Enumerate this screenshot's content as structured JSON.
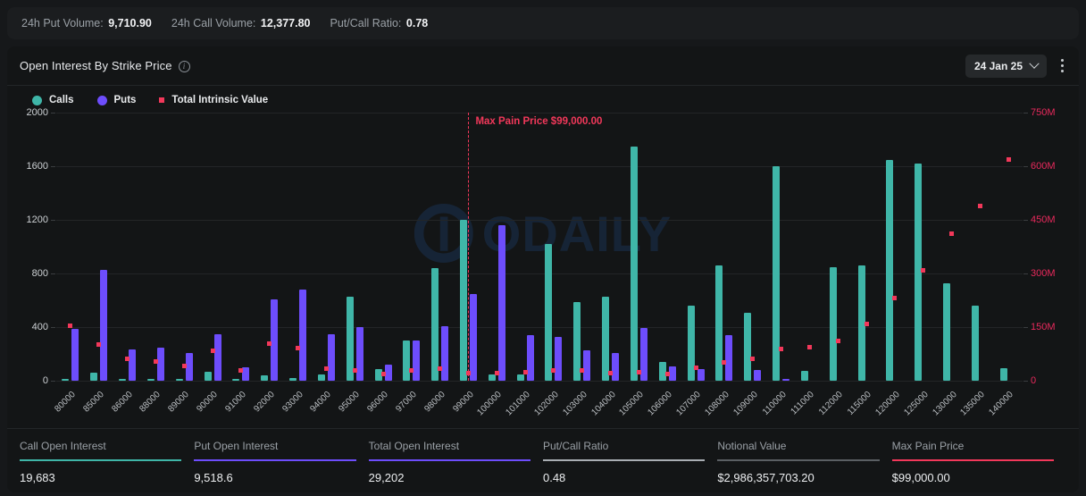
{
  "volume_bar": {
    "items": [
      {
        "label": "24h Put Volume:",
        "value": "9,710.90"
      },
      {
        "label": "24h Call Volume:",
        "value": "12,377.80"
      },
      {
        "label": "Put/Call Ratio:",
        "value": "0.78"
      }
    ]
  },
  "card": {
    "title": "Open Interest By Strike Price",
    "info_icon": "info-icon",
    "date_picker": {
      "label": "24 Jan 25",
      "icon": "chevron-down-icon"
    },
    "menu_icon": "kebab-menu-icon"
  },
  "legend": [
    {
      "label": "Calls",
      "color": "#3fb6a8",
      "shape": "circle"
    },
    {
      "label": "Puts",
      "color": "#6d4dfc",
      "shape": "circle"
    },
    {
      "label": "Total Intrinsic Value",
      "color": "#f2385a",
      "shape": "square"
    }
  ],
  "watermark": {
    "text": "ODAILY"
  },
  "chart_data": {
    "type": "bar",
    "title": "Open Interest By Strike Price",
    "xlabel": "",
    "ylabel": "",
    "grid": true,
    "legend_position": "top-left",
    "ylim": [
      0,
      2000
    ],
    "yticks": [
      0,
      400,
      800,
      1200,
      1600,
      2000
    ],
    "ytick_labels": [
      "0",
      "400",
      "800",
      "1200",
      "1600",
      "2000"
    ],
    "y2lim": [
      0,
      750000000
    ],
    "y2ticks": [
      0,
      150000000,
      300000000,
      450000000,
      600000000,
      750000000
    ],
    "y2tick_labels": [
      "0",
      "150M",
      "300M",
      "450M",
      "600M",
      "750M"
    ],
    "categories": [
      "80000",
      "85000",
      "86000",
      "88000",
      "89000",
      "90000",
      "91000",
      "92000",
      "93000",
      "94000",
      "95000",
      "96000",
      "97000",
      "98000",
      "99000",
      "100000",
      "101000",
      "102000",
      "103000",
      "104000",
      "105000",
      "106000",
      "107000",
      "108000",
      "109000",
      "110000",
      "111000",
      "112000",
      "115000",
      "120000",
      "125000",
      "130000",
      "135000",
      "140000"
    ],
    "series": [
      {
        "name": "Calls",
        "axis": "left",
        "color": "#3fb6a8",
        "values": [
          12,
          62,
          8,
          10,
          4,
          66,
          14,
          38,
          22,
          50,
          625,
          90,
          300,
          840,
          1200,
          48,
          50,
          1020,
          590,
          630,
          1750,
          140,
          560,
          860,
          510,
          1600,
          75,
          845,
          860,
          1650,
          1620,
          730,
          560,
          95
        ]
      },
      {
        "name": "Puts",
        "axis": "left",
        "color": "#6d4dfc",
        "values": [
          390,
          830,
          235,
          250,
          210,
          345,
          100,
          605,
          680,
          350,
          400,
          120,
          300,
          405,
          645,
          1160,
          340,
          325,
          225,
          210,
          395,
          110,
          90,
          340,
          80,
          10,
          0,
          0,
          0,
          0,
          0,
          0,
          0,
          0
        ]
      },
      {
        "name": "Total Intrinsic Value",
        "axis": "right",
        "type": "scatter",
        "color": "#f2385a",
        "values": [
          155000000,
          102000000,
          62000000,
          55000000,
          42000000,
          84000000,
          30000000,
          105000000,
          92000000,
          35000000,
          30000000,
          20000000,
          28000000,
          33000000,
          22000000,
          22000000,
          24000000,
          29000000,
          28000000,
          22000000,
          25000000,
          20000000,
          36000000,
          52000000,
          62000000,
          88000000,
          95000000,
          112000000,
          160000000,
          232000000,
          310000000,
          412000000,
          490000000,
          620000000
        ]
      }
    ],
    "annotation": {
      "label": "Max Pain Price $99,000.00",
      "at_category": "99000",
      "color": "#f2385a",
      "style": "dashed-vline"
    }
  },
  "stats": [
    {
      "label": "Call Open Interest",
      "value": "19,683",
      "color": "#3fb6a8"
    },
    {
      "label": "Put Open Interest",
      "value": "9,518.6",
      "color": "#6d4dfc"
    },
    {
      "label": "Total Open Interest",
      "value": "29,202",
      "color": "#6d4dfc"
    },
    {
      "label": "Put/Call Ratio",
      "value": "0.48",
      "color": "#a9aeb3"
    },
    {
      "label": "Notional Value",
      "value": "$2,986,357,703.20",
      "color": "#5a5f63"
    },
    {
      "label": "Max Pain Price",
      "value": "$99,000.00",
      "color": "#f2385a"
    }
  ]
}
